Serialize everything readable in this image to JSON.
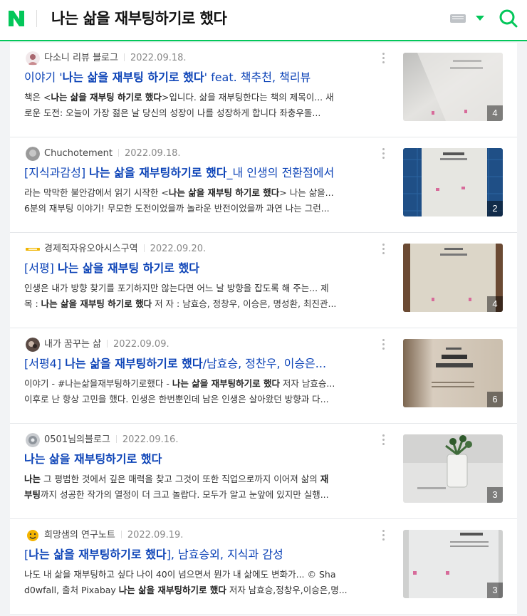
{
  "header": {
    "query": "나는 삶을 재부팅하기로 했다",
    "brand_color": "#03c75a"
  },
  "results": [
    {
      "author": "다소니 리뷰 블로그",
      "date": "2022.09.18.",
      "title_pre": "이야기 '",
      "title_hl": "나는 삶을 재부팅 하기로 했다",
      "title_post": "' feat. 책추천, 책리뷰",
      "desc1_pre": "책은 <",
      "desc1_hl": "나는 삶을 재부팅 하기로 했다",
      "desc1_post": ">입니다. 삶을 재부팅한다는 책의 제목이... 새",
      "desc2": "로운 도전: 오늘이 가장 젊은 날 당신의 성장이 나를 성장하게 합니다 좌충우돌...",
      "image_count": "4"
    },
    {
      "author": "Chuchotement",
      "date": "2022.09.18.",
      "title_pre": "[지식과감성] ",
      "title_hl": "나는 삶을 재부팅하기로 했다",
      "title_post": "_내 인생의 전환점에서",
      "desc1_pre": "라는 막막한 불안감에서 읽기 시작한 <",
      "desc1_hl": "나는 삶을 재부팅 하기로 했다",
      "desc1_post": "> 나는 삶을...",
      "desc2": "6분의 재부팅 이야기! 무모한 도전이었을까 놀라운 반전이었을까 과연 나는 그런...",
      "image_count": "2"
    },
    {
      "author": "경제적자유오아시스구역",
      "date": "2022.09.20.",
      "title_pre": "[서평] ",
      "title_hl": "나는 삶을 재부팅 하기로 했다",
      "title_post": "",
      "desc1_pre": "인생은 내가 방향 찾기를 포기하지만 않는다면 어느 날 방향을 잡도록 해 주는... 제",
      "desc1_hl": "",
      "desc1_post": "",
      "desc2_pre": "목 : ",
      "desc2_hl": "나는 삶을 재부팅 하기로 했다",
      "desc2_post": " 저 자 : 남효승, 정창우, 이승은, 명성환, 최진관...",
      "image_count": "4"
    },
    {
      "author": "내가 꿈꾸는 삶",
      "date": "2022.09.09.",
      "title_pre": "[서평4] ",
      "title_hl": "나는 삶을 재부팅하기로 했다",
      "title_post": "/남효승, 정찬우, 이승은...",
      "desc1_pre": "이야기 - #나는삶을재부팅하기로했다 - ",
      "desc1_hl": "나는 삶을 재부팅하기로 했다",
      "desc1_post": " 저자 남효승...",
      "desc2": "이후로 난 항상 고민을 했다. 인생은 한번뿐인데 남은 인생은 살아왔던 방향과 다...",
      "image_count": "6"
    },
    {
      "author": "0501님의블로그",
      "date": "2022.09.16.",
      "title_pre": "",
      "title_hl": "나는 삶을 재부팅하기로 했다",
      "title_post": "",
      "desc1_pre": "",
      "desc1_hl": "나는",
      "desc1_post": " 그 평범한 것에서 깊은 매력을 찾고 그것이 또한 직업으로까지 이어져 삶의 ",
      "desc1_hl2": "재",
      "desc2_pre": "",
      "desc2_hl": "부팅",
      "desc2_post": "까지 성공한 작가의 열정이 더 크고 놀랍다. 모두가 알고 눈앞에 있지만 실행...",
      "image_count": "3"
    },
    {
      "author": "희망샘의 연구노트",
      "date": "2022.09.19.",
      "title_pre": "[",
      "title_hl": "나는 삶을 재부팅하기로 했다",
      "title_post": "], 남효승외, 지식과 감성",
      "desc1_pre": "나도 내 삶을 재부팅하고 싶다 나이 40이 넘으면서 뭔가 내 삶에도 변화가... © Sha",
      "desc1_hl": "",
      "desc1_post": "",
      "desc2_pre": "d0wfall, 출처 Pixabay ",
      "desc2_hl": "나는 삶을 재부팅하기로 했다",
      "desc2_post": " 저자 남효승,정창우,이승은,명...",
      "image_count": "3"
    }
  ]
}
